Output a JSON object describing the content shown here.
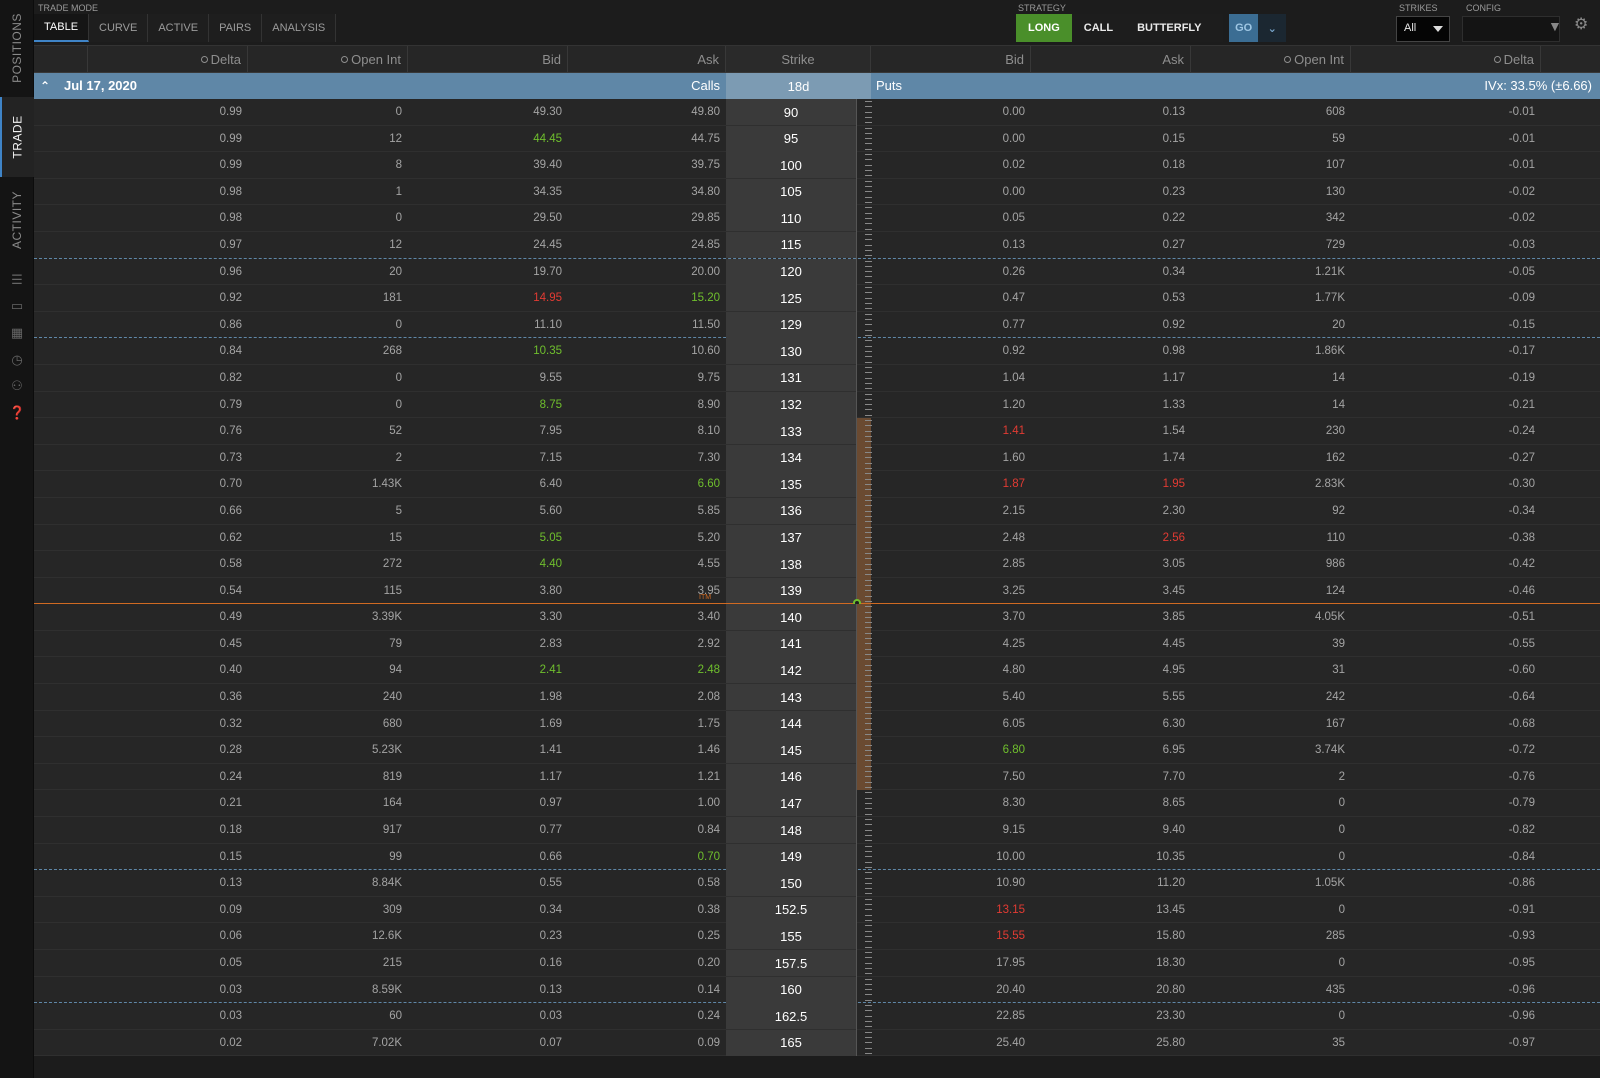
{
  "sidebar": {
    "tabs": [
      {
        "label": "POSITIONS",
        "active": false
      },
      {
        "label": "TRADE",
        "active": true
      },
      {
        "label": "ACTIVITY",
        "active": false
      }
    ],
    "icons": [
      "list-icon",
      "monitor-icon",
      "calendar-icon",
      "clock-icon",
      "people-icon",
      "help-icon"
    ]
  },
  "toolbar": {
    "trade_mode_label": "TRADE MODE",
    "mode_tabs": [
      {
        "label": "TABLE",
        "active": true
      },
      {
        "label": "CURVE",
        "active": false
      },
      {
        "label": "ACTIVE",
        "active": false
      },
      {
        "label": "PAIRS",
        "active": false
      },
      {
        "label": "ANALYSIS",
        "active": false
      }
    ],
    "strategy_label": "STRATEGY",
    "strategy": {
      "direction": "LONG",
      "type": "CALL",
      "structure": "BUTTERFLY",
      "go": "GO"
    },
    "strikes_label": "STRIKES",
    "strikes_value": "All",
    "config_label": "CONFIG"
  },
  "columns": {
    "calls": [
      "Delta",
      "Open Int",
      "Bid",
      "Ask"
    ],
    "strike": "Strike",
    "puts": [
      "Bid",
      "Ask",
      "Open Int",
      "Delta"
    ]
  },
  "expiration": {
    "date": "Jul 17, 2020",
    "calls_label": "Calls",
    "days": "18d",
    "puts_label": "Puts",
    "ivx": "IVx: 33.5% (±6.66)"
  },
  "colors": {
    "accent": "#5f87a7",
    "up": "#6fbf2d",
    "down": "#e23b33",
    "price_line": "#d06a22",
    "long": "#4a8f2a"
  },
  "itm_label": "ITM",
  "rows": [
    {
      "strike": "90",
      "c_delta": "0.99",
      "c_oi": "0",
      "c_bid": "49.30",
      "c_ask": "49.80",
      "p_bid": "0.00",
      "p_ask": "0.13",
      "p_oi": "608",
      "p_delta": "-0.01"
    },
    {
      "strike": "95",
      "c_delta": "0.99",
      "c_oi": "12",
      "c_bid": "44.45",
      "c_ask": "44.75",
      "p_bid": "0.00",
      "p_ask": "0.15",
      "p_oi": "59",
      "p_delta": "-0.01",
      "c_bid_c": "up"
    },
    {
      "strike": "100",
      "c_delta": "0.99",
      "c_oi": "8",
      "c_bid": "39.40",
      "c_ask": "39.75",
      "p_bid": "0.02",
      "p_ask": "0.18",
      "p_oi": "107",
      "p_delta": "-0.01"
    },
    {
      "strike": "105",
      "c_delta": "0.98",
      "c_oi": "1",
      "c_bid": "34.35",
      "c_ask": "34.80",
      "p_bid": "0.00",
      "p_ask": "0.23",
      "p_oi": "130",
      "p_delta": "-0.02"
    },
    {
      "strike": "110",
      "c_delta": "0.98",
      "c_oi": "0",
      "c_bid": "29.50",
      "c_ask": "29.85",
      "p_bid": "0.05",
      "p_ask": "0.22",
      "p_oi": "342",
      "p_delta": "-0.02"
    },
    {
      "strike": "115",
      "c_delta": "0.97",
      "c_oi": "12",
      "c_bid": "24.45",
      "c_ask": "24.85",
      "p_bid": "0.13",
      "p_ask": "0.27",
      "p_oi": "729",
      "p_delta": "-0.03",
      "dash": true
    },
    {
      "strike": "120",
      "c_delta": "0.96",
      "c_oi": "20",
      "c_bid": "19.70",
      "c_ask": "20.00",
      "p_bid": "0.26",
      "p_ask": "0.34",
      "p_oi": "1.21K",
      "p_delta": "-0.05"
    },
    {
      "strike": "125",
      "c_delta": "0.92",
      "c_oi": "181",
      "c_bid": "14.95",
      "c_ask": "15.20",
      "p_bid": "0.47",
      "p_ask": "0.53",
      "p_oi": "1.77K",
      "p_delta": "-0.09",
      "c_bid_c": "down",
      "c_ask_c": "up"
    },
    {
      "strike": "129",
      "c_delta": "0.86",
      "c_oi": "0",
      "c_bid": "11.10",
      "c_ask": "11.50",
      "p_bid": "0.77",
      "p_ask": "0.92",
      "p_oi": "20",
      "p_delta": "-0.15",
      "dash": true
    },
    {
      "strike": "130",
      "c_delta": "0.84",
      "c_oi": "268",
      "c_bid": "10.35",
      "c_ask": "10.60",
      "p_bid": "0.92",
      "p_ask": "0.98",
      "p_oi": "1.86K",
      "p_delta": "-0.17",
      "c_bid_c": "up"
    },
    {
      "strike": "131",
      "c_delta": "0.82",
      "c_oi": "0",
      "c_bid": "9.55",
      "c_ask": "9.75",
      "p_bid": "1.04",
      "p_ask": "1.17",
      "p_oi": "14",
      "p_delta": "-0.19"
    },
    {
      "strike": "132",
      "c_delta": "0.79",
      "c_oi": "0",
      "c_bid": "8.75",
      "c_ask": "8.90",
      "p_bid": "1.20",
      "p_ask": "1.33",
      "p_oi": "14",
      "p_delta": "-0.21",
      "c_bid_c": "up"
    },
    {
      "strike": "133",
      "c_delta": "0.76",
      "c_oi": "52",
      "c_bid": "7.95",
      "c_ask": "8.10",
      "p_bid": "1.41",
      "p_ask": "1.54",
      "p_oi": "230",
      "p_delta": "-0.24",
      "p_bid_c": "down",
      "itm": true
    },
    {
      "strike": "134",
      "c_delta": "0.73",
      "c_oi": "2",
      "c_bid": "7.15",
      "c_ask": "7.30",
      "p_bid": "1.60",
      "p_ask": "1.74",
      "p_oi": "162",
      "p_delta": "-0.27",
      "itm": true
    },
    {
      "strike": "135",
      "c_delta": "0.70",
      "c_oi": "1.43K",
      "c_bid": "6.40",
      "c_ask": "6.60",
      "p_bid": "1.87",
      "p_ask": "1.95",
      "p_oi": "2.83K",
      "p_delta": "-0.30",
      "c_ask_c": "up",
      "p_bid_c": "down",
      "p_ask_c": "down",
      "itm": true
    },
    {
      "strike": "136",
      "c_delta": "0.66",
      "c_oi": "5",
      "c_bid": "5.60",
      "c_ask": "5.85",
      "p_bid": "2.15",
      "p_ask": "2.30",
      "p_oi": "92",
      "p_delta": "-0.34",
      "itm": true
    },
    {
      "strike": "137",
      "c_delta": "0.62",
      "c_oi": "15",
      "c_bid": "5.05",
      "c_ask": "5.20",
      "p_bid": "2.48",
      "p_ask": "2.56",
      "p_oi": "110",
      "p_delta": "-0.38",
      "c_bid_c": "up",
      "p_ask_c": "down",
      "itm": true
    },
    {
      "strike": "138",
      "c_delta": "0.58",
      "c_oi": "272",
      "c_bid": "4.40",
      "c_ask": "4.55",
      "p_bid": "2.85",
      "p_ask": "3.05",
      "p_oi": "986",
      "p_delta": "-0.42",
      "c_bid_c": "up",
      "itm": true
    },
    {
      "strike": "139",
      "c_delta": "0.54",
      "c_oi": "115",
      "c_bid": "3.80",
      "c_ask": "3.95",
      "p_bid": "3.25",
      "p_ask": "3.45",
      "p_oi": "124",
      "p_delta": "-0.46",
      "itm": true,
      "price_after": true
    },
    {
      "strike": "140",
      "c_delta": "0.49",
      "c_oi": "3.39K",
      "c_bid": "3.30",
      "c_ask": "3.40",
      "p_bid": "3.70",
      "p_ask": "3.85",
      "p_oi": "4.05K",
      "p_delta": "-0.51",
      "itm": true
    },
    {
      "strike": "141",
      "c_delta": "0.45",
      "c_oi": "79",
      "c_bid": "2.83",
      "c_ask": "2.92",
      "p_bid": "4.25",
      "p_ask": "4.45",
      "p_oi": "39",
      "p_delta": "-0.55",
      "itm": true
    },
    {
      "strike": "142",
      "c_delta": "0.40",
      "c_oi": "94",
      "c_bid": "2.41",
      "c_ask": "2.48",
      "p_bid": "4.80",
      "p_ask": "4.95",
      "p_oi": "31",
      "p_delta": "-0.60",
      "c_bid_c": "up",
      "c_ask_c": "up",
      "itm": true
    },
    {
      "strike": "143",
      "c_delta": "0.36",
      "c_oi": "240",
      "c_bid": "1.98",
      "c_ask": "2.08",
      "p_bid": "5.40",
      "p_ask": "5.55",
      "p_oi": "242",
      "p_delta": "-0.64",
      "itm": true
    },
    {
      "strike": "144",
      "c_delta": "0.32",
      "c_oi": "680",
      "c_bid": "1.69",
      "c_ask": "1.75",
      "p_bid": "6.05",
      "p_ask": "6.30",
      "p_oi": "167",
      "p_delta": "-0.68",
      "itm": true
    },
    {
      "strike": "145",
      "c_delta": "0.28",
      "c_oi": "5.23K",
      "c_bid": "1.41",
      "c_ask": "1.46",
      "p_bid": "6.80",
      "p_ask": "6.95",
      "p_oi": "3.74K",
      "p_delta": "-0.72",
      "p_bid_c": "up",
      "itm": true
    },
    {
      "strike": "146",
      "c_delta": "0.24",
      "c_oi": "819",
      "c_bid": "1.17",
      "c_ask": "1.21",
      "p_bid": "7.50",
      "p_ask": "7.70",
      "p_oi": "2",
      "p_delta": "-0.76",
      "itm": true
    },
    {
      "strike": "147",
      "c_delta": "0.21",
      "c_oi": "164",
      "c_bid": "0.97",
      "c_ask": "1.00",
      "p_bid": "8.30",
      "p_ask": "8.65",
      "p_oi": "0",
      "p_delta": "-0.79"
    },
    {
      "strike": "148",
      "c_delta": "0.18",
      "c_oi": "917",
      "c_bid": "0.77",
      "c_ask": "0.84",
      "p_bid": "9.15",
      "p_ask": "9.40",
      "p_oi": "0",
      "p_delta": "-0.82"
    },
    {
      "strike": "149",
      "c_delta": "0.15",
      "c_oi": "99",
      "c_bid": "0.66",
      "c_ask": "0.70",
      "p_bid": "10.00",
      "p_ask": "10.35",
      "p_oi": "0",
      "p_delta": "-0.84",
      "c_ask_c": "up",
      "dash": true
    },
    {
      "strike": "150",
      "c_delta": "0.13",
      "c_oi": "8.84K",
      "c_bid": "0.55",
      "c_ask": "0.58",
      "p_bid": "10.90",
      "p_ask": "11.20",
      "p_oi": "1.05K",
      "p_delta": "-0.86"
    },
    {
      "strike": "152.5",
      "c_delta": "0.09",
      "c_oi": "309",
      "c_bid": "0.34",
      "c_ask": "0.38",
      "p_bid": "13.15",
      "p_ask": "13.45",
      "p_oi": "0",
      "p_delta": "-0.91",
      "p_bid_c": "down"
    },
    {
      "strike": "155",
      "c_delta": "0.06",
      "c_oi": "12.6K",
      "c_bid": "0.23",
      "c_ask": "0.25",
      "p_bid": "15.55",
      "p_ask": "15.80",
      "p_oi": "285",
      "p_delta": "-0.93",
      "p_bid_c": "down"
    },
    {
      "strike": "157.5",
      "c_delta": "0.05",
      "c_oi": "215",
      "c_bid": "0.16",
      "c_ask": "0.20",
      "p_bid": "17.95",
      "p_ask": "18.30",
      "p_oi": "0",
      "p_delta": "-0.95"
    },
    {
      "strike": "160",
      "c_delta": "0.03",
      "c_oi": "8.59K",
      "c_bid": "0.13",
      "c_ask": "0.14",
      "p_bid": "20.40",
      "p_ask": "20.80",
      "p_oi": "435",
      "p_delta": "-0.96",
      "dash": true
    },
    {
      "strike": "162.5",
      "c_delta": "0.03",
      "c_oi": "60",
      "c_bid": "0.03",
      "c_ask": "0.24",
      "p_bid": "22.85",
      "p_ask": "23.30",
      "p_oi": "0",
      "p_delta": "-0.96"
    },
    {
      "strike": "165",
      "c_delta": "0.02",
      "c_oi": "7.02K",
      "c_bid": "0.07",
      "c_ask": "0.09",
      "p_bid": "25.40",
      "p_ask": "25.80",
      "p_oi": "35",
      "p_delta": "-0.97"
    }
  ]
}
